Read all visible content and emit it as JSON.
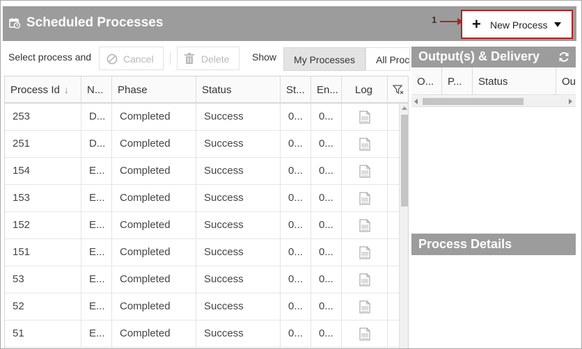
{
  "header": {
    "title": "Scheduled Processes",
    "icon": "calendar-clock-icon",
    "annotation_number": "1",
    "new_process_label": "New Process",
    "annotation_color": "#b22222"
  },
  "toolbar": {
    "select_text": "Select process and",
    "cancel_label": "Cancel",
    "delete_label": "Delete",
    "show_label": "Show",
    "tab_my": "My Processes",
    "tab_all": "All Processes"
  },
  "grid": {
    "columns": [
      "Process Id",
      "N...",
      "Phase",
      "Status",
      "St...",
      "En...",
      "Log"
    ],
    "rows": [
      {
        "id": "253",
        "name": "D...",
        "phase": "Completed",
        "status": "Success",
        "start": "0...",
        "end": "0..."
      },
      {
        "id": "251",
        "name": "D...",
        "phase": "Completed",
        "status": "Success",
        "start": "0...",
        "end": "0..."
      },
      {
        "id": "154",
        "name": "E...",
        "phase": "Completed",
        "status": "Success",
        "start": "0...",
        "end": "0..."
      },
      {
        "id": "153",
        "name": "E...",
        "phase": "Completed",
        "status": "Success",
        "start": "0...",
        "end": "0..."
      },
      {
        "id": "152",
        "name": "E...",
        "phase": "Completed",
        "status": "Success",
        "start": "0...",
        "end": "0..."
      },
      {
        "id": "151",
        "name": "E...",
        "phase": "Completed",
        "status": "Success",
        "start": "0...",
        "end": "0..."
      },
      {
        "id": "53",
        "name": "E...",
        "phase": "Completed",
        "status": "Success",
        "start": "0...",
        "end": "0..."
      },
      {
        "id": "52",
        "name": "E...",
        "phase": "Completed",
        "status": "Success",
        "start": "0...",
        "end": "0..."
      },
      {
        "id": "51",
        "name": "E...",
        "phase": "Completed",
        "status": "Success",
        "start": "0...",
        "end": "0..."
      }
    ]
  },
  "output_panel": {
    "title": "Output(s) & Delivery",
    "columns": [
      "O...",
      "P...",
      "Status",
      "Ou..."
    ]
  },
  "details_panel": {
    "title": "Process Details"
  }
}
